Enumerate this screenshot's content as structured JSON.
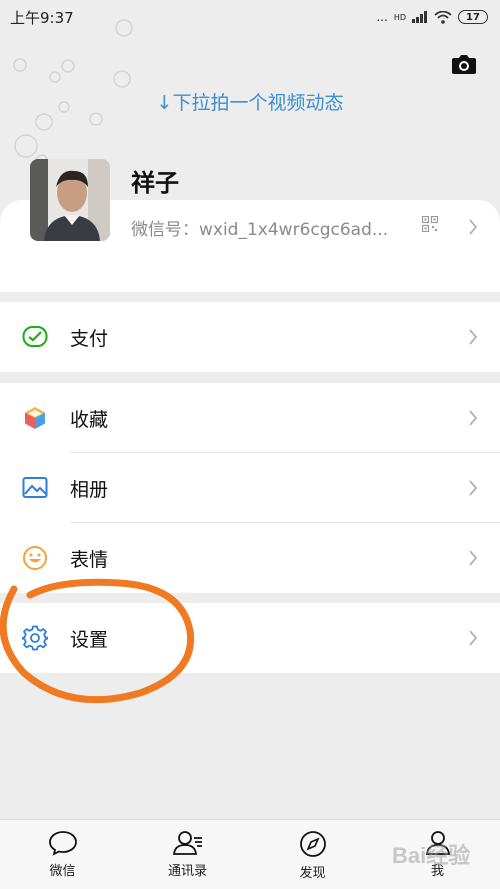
{
  "status_bar": {
    "time": "上午9:37",
    "signal": "...",
    "hd": "HD",
    "battery": "17"
  },
  "header": {
    "pull_hint": "↓下拉拍一个视频动态"
  },
  "profile": {
    "name": "祥子",
    "wxid": "微信号：wxid_1x4wr6cgc6ad..."
  },
  "menu": {
    "pay": "支付",
    "favorites": "收藏",
    "album": "相册",
    "stickers": "表情",
    "settings": "设置"
  },
  "tabs": [
    {
      "label": "微信"
    },
    {
      "label": "通讯录"
    },
    {
      "label": "发现"
    },
    {
      "label": "我"
    }
  ],
  "watermark": "Bai经验",
  "colors": {
    "accent_blue": "#3a8fd6",
    "pay_green": "#1aad19",
    "annotation_orange": "#f07a22"
  }
}
